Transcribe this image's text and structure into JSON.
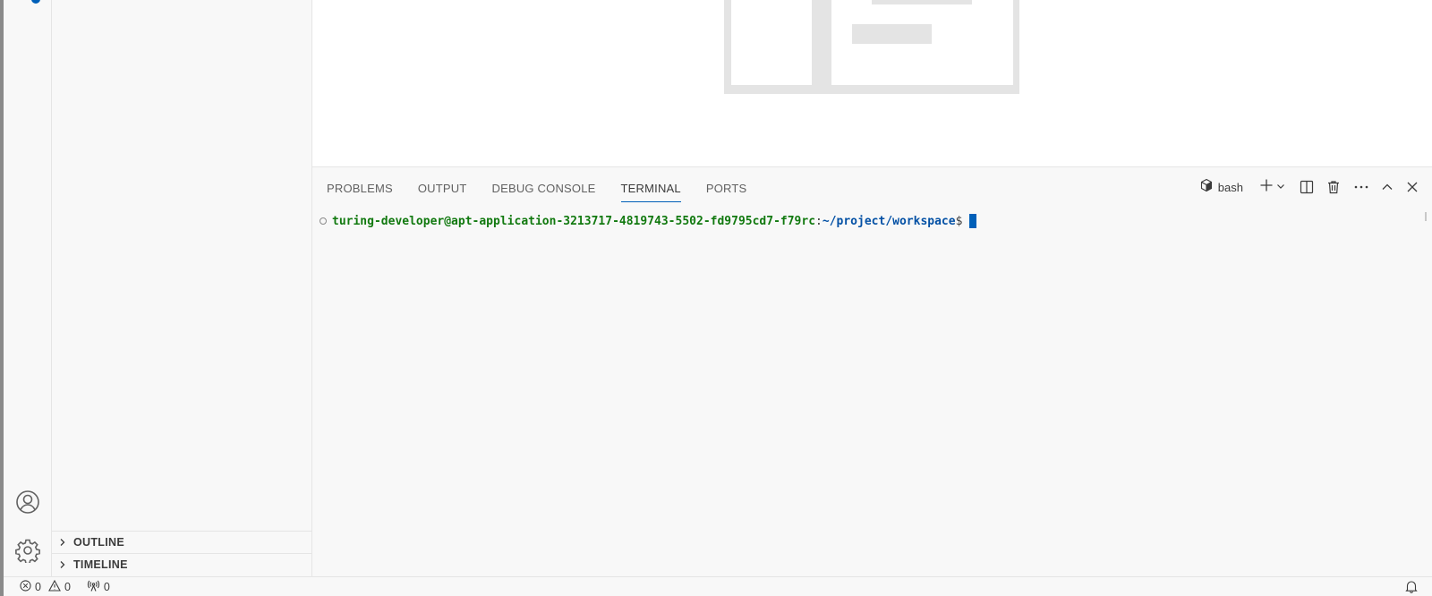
{
  "panel": {
    "tabs": [
      {
        "label": "PROBLEMS"
      },
      {
        "label": "OUTPUT"
      },
      {
        "label": "DEBUG CONSOLE"
      },
      {
        "label": "TERMINAL",
        "active": true
      },
      {
        "label": "PORTS"
      }
    ],
    "shell_label": "bash"
  },
  "terminal": {
    "user_host": "turing-developer@apt-application-3213717-4819743-5502-fd9795cd7-f79rc",
    "colon": ":",
    "path": "~/project/workspace",
    "dollar": "$"
  },
  "sidebar": {
    "sections": [
      {
        "label": "OUTLINE"
      },
      {
        "label": "TIMELINE"
      }
    ]
  },
  "statusbar": {
    "errors": "0",
    "warnings": "0",
    "ports": "0"
  },
  "colors": {
    "accent": "#005fb8",
    "terminal_user": "#11790f",
    "terminal_path": "#0451a5"
  },
  "icons": {
    "activity": [
      "account-icon",
      "gear-icon"
    ],
    "panel_actions": [
      "terminal-shell-icon",
      "plus-icon",
      "chevron-down-icon",
      "split-icon",
      "trash-icon",
      "ellipsis-icon",
      "chevron-up-icon",
      "close-icon"
    ],
    "status": [
      "error-icon",
      "warning-icon",
      "broadcast-icon",
      "bell-icon"
    ]
  }
}
